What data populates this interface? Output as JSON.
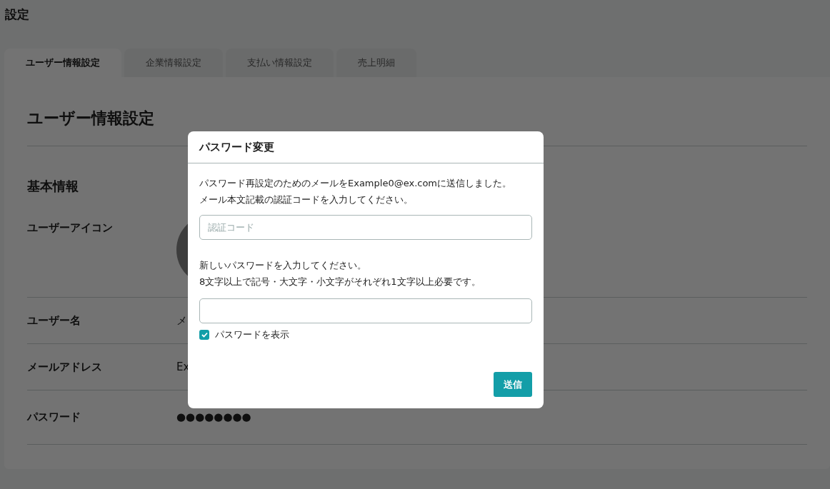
{
  "page_title": "設定",
  "tabs": [
    {
      "label": "ユーザー情報設定",
      "selected": true
    },
    {
      "label": "企業情報設定",
      "selected": false
    },
    {
      "label": "支払い情報設定",
      "selected": false
    },
    {
      "label": "売上明細",
      "selected": false
    }
  ],
  "panel": {
    "heading": "ユーザー情報設定",
    "section": "基本情報",
    "rows": [
      {
        "kind": "avatar",
        "label": "ユーザーアイコン"
      },
      {
        "kind": "text",
        "label": "ユーザー名",
        "value": "メ"
      },
      {
        "kind": "text",
        "label": "メールアドレス",
        "value": "Ex"
      },
      {
        "kind": "text",
        "label": "パスワード",
        "value": "●●●●●●●●"
      }
    ]
  },
  "dialog": {
    "title": "パスワード変更",
    "message_lines": [
      "パスワード再設定のためのメールをExample0@ex.comに送信しました。",
      "メール本文記載の認証コードを入力してください。"
    ],
    "code_field": {
      "placeholder": "認証コード"
    },
    "password_lines": [
      "新しいパスワードを入力してください。",
      "8文字以上で記号・大文字・小文字がそれぞれ1文字以上必要です。"
    ],
    "show_password": {
      "label": "パスワードを表示",
      "checked": true
    },
    "submit": "送信"
  }
}
